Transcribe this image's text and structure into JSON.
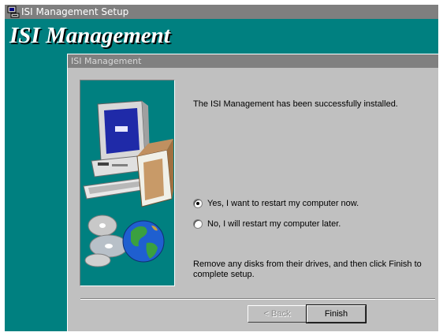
{
  "window": {
    "title": "ISI Management Setup"
  },
  "setup": {
    "heading": "ISI Management"
  },
  "dialog": {
    "title": "ISI Management",
    "message": "The ISI Management has been successfully installed.",
    "options": [
      {
        "label": "Yes, I want to restart my computer now.",
        "selected": true
      },
      {
        "label": "No, I will restart my computer later.",
        "selected": false
      }
    ],
    "instruction": "Remove any disks from their drives, and then click Finish to complete setup.",
    "buttons": {
      "back": "< Back",
      "finish": "Finish"
    }
  },
  "colors": {
    "desktop": "#008080",
    "dialog": "#c0c0c0",
    "titlebar": "#808080"
  },
  "icons": [
    "setup-app-icon",
    "computer-illustration",
    "cd-disc-icon",
    "globe-icon"
  ]
}
